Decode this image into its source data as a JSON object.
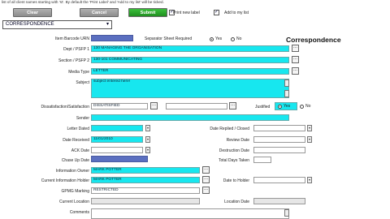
{
  "top_note": "list of all client names starting with 'st'. By default the 'Print Label' and 'Add to my list' will be ticked.",
  "toolbar": {
    "clear_label": "Clear",
    "cancel_label": "Cancel",
    "submit_label": "Submit",
    "print_label": "Print new label",
    "add_to_list_label": "Add to my list",
    "print_checked": "✓",
    "add_checked": "✓"
  },
  "type_select": {
    "value": "CORRESPONDENCE",
    "arrow": "▾"
  },
  "form_heading": "Correspondence",
  "labels": {
    "barcode": "Item Barcode URN",
    "separator": "Separator Sheet Required",
    "yes": "Yes",
    "no": "No",
    "dept": "Dept / PSFP 1",
    "section": "Section / PSFP 2",
    "media": "Media Type",
    "subject": "Subject",
    "dissat": "Dissatisfaction/Satisfaction",
    "justified": "Justified",
    "sender": "Sender",
    "letter_dated": "Letter Dated",
    "date_replied": "Date Replied / Closed",
    "date_received": "Date Received",
    "review_date": "Review Date",
    "ack_date": "ACK Date",
    "destruction_date": "Destruction Date",
    "chase_up": "Chase Up Date",
    "total_days": "Total Days Taken",
    "info_owner": "Information Owner",
    "current_holder": "Current Information Holder",
    "date_to_holder": "Date to Holder",
    "gpmg": "GPMG Marking",
    "current_location": "Current Location",
    "location_date": "Location Date",
    "comments": "Comments"
  },
  "values": {
    "dept": "130 MANAGING THE ORGANISATION",
    "section": "130-101 COMMUNICATING",
    "media": "LETTER",
    "subject": "subject entered here!",
    "dissat": "DISSATISFIED",
    "date_received": "11/01/2010",
    "info_owner": "MARK POTTER",
    "current_holder": "MARK POTTER",
    "gpmg": "RESTRICTED"
  },
  "icons": {
    "ellipsis": "...",
    "dropdown": "▾"
  }
}
